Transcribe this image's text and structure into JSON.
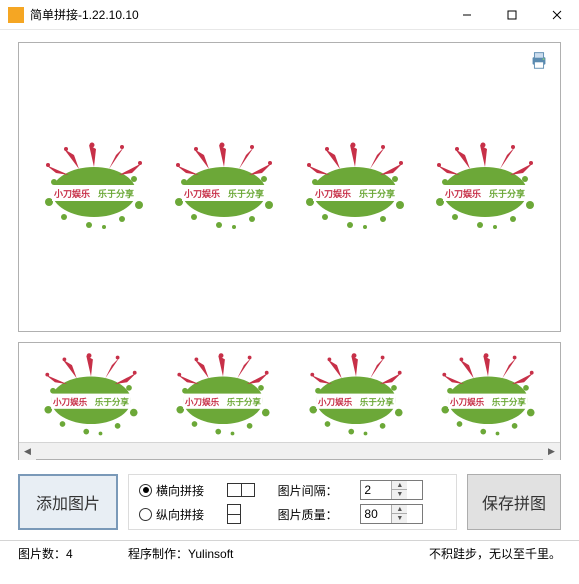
{
  "titlebar": {
    "title": "简单拼接-1.22.10.10"
  },
  "buttons": {
    "add": "添加图片",
    "save": "保存拼图"
  },
  "options": {
    "horizontal": "横向拼接",
    "vertical": "纵向拼接",
    "gap_label": "图片间隔：",
    "quality_label": "图片质量：",
    "gap_value": "2",
    "quality_value": "80"
  },
  "status": {
    "count_label": "图片数：",
    "count_value": "4",
    "author_label": "程序制作：",
    "author_value": "Yulinsoft",
    "motto": "不积跬步，无以至千里。"
  },
  "image_text": {
    "left": "小刀娱乐",
    "right": "乐于分享"
  }
}
